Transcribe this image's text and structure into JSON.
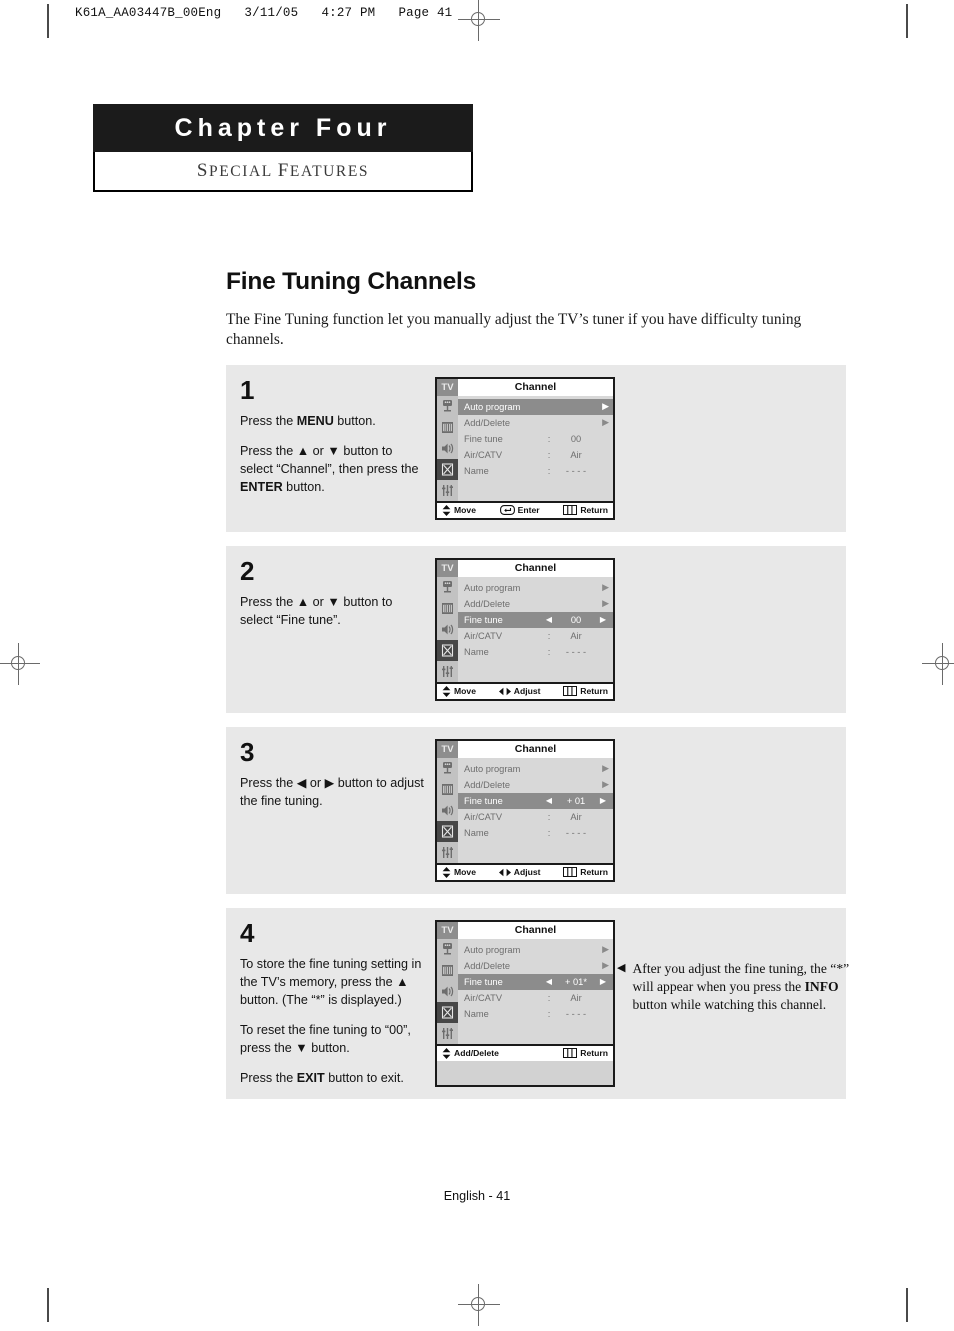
{
  "print_slug": "K61A_AA03447B_00Eng   3/11/05   4:27 PM   Page 41",
  "chapter": {
    "title": "Chapter Four",
    "subtitle_small_caps": "S",
    "subtitle": "PECIAL ",
    "subtitle_small_caps2": "F",
    "subtitle2": "EATURES",
    "subtitle_full": "SPECIAL FEATURES"
  },
  "section": {
    "title": "Fine Tuning Channels",
    "intro": "The Fine Tuning function let you manually adjust the TV’s tuner if you have difficulty tuning channels."
  },
  "osd_common": {
    "tv_tag": "TV",
    "menu_title": "Channel",
    "icons": [
      "antenna-icon",
      "picture-icon",
      "speaker-icon",
      "setup-icon",
      "equalizer-icon"
    ],
    "selected_icon_index": 3,
    "labels": {
      "auto_program": "Auto program",
      "add_delete": "Add/Delete",
      "fine_tune": "Fine tune",
      "air_catv": "Air/CATV",
      "name": "Name"
    },
    "values": {
      "air_catv": "Air",
      "name": "- - - -"
    },
    "footer_labels": {
      "move": "Move",
      "enter": "Enter",
      "return": "Return",
      "adjust": "Adjust",
      "add_delete": "Add/Delete"
    }
  },
  "steps": [
    {
      "number": "1",
      "paragraphs": [
        {
          "parts": [
            {
              "t": "Press the ",
              "b": false
            },
            {
              "t": "MENU",
              "b": true
            },
            {
              "t": " button.",
              "b": false
            }
          ]
        },
        {
          "parts": [
            {
              "t": "Press the ▲ or ▼ button to select “Channel”, then press the ",
              "b": false
            },
            {
              "t": "ENTER",
              "b": true
            },
            {
              "t": " button.",
              "b": false
            }
          ]
        }
      ],
      "osd": {
        "highlight_row": "auto_program",
        "fine_tune_value": "00",
        "fine_tune_has_arrows": false,
        "footer": [
          "move",
          "enter",
          "return"
        ]
      }
    },
    {
      "number": "2",
      "paragraphs": [
        {
          "parts": [
            {
              "t": "Press the ▲ or ▼ button to select “Fine tune”.",
              "b": false
            }
          ]
        }
      ],
      "osd": {
        "highlight_row": "fine_tune",
        "fine_tune_value": "00",
        "fine_tune_has_arrows": true,
        "footer": [
          "move",
          "adjust",
          "return"
        ]
      }
    },
    {
      "number": "3",
      "paragraphs": [
        {
          "parts": [
            {
              "t": "Press the ◀ or ▶ button to adjust the fine tuning.",
              "b": false
            }
          ]
        }
      ],
      "osd": {
        "highlight_row": "fine_tune",
        "fine_tune_value": "+ 01",
        "fine_tune_has_arrows": true,
        "footer": [
          "move",
          "adjust",
          "return"
        ]
      }
    },
    {
      "number": "4",
      "paragraphs": [
        {
          "parts": [
            {
              "t": "To store the fine tuning setting in the TV’s memory, press the ▲ button. (The “*” is displayed.)",
              "b": false
            }
          ]
        },
        {
          "parts": [
            {
              "t": "To reset the fine tuning to “00”, press the ▼ button.",
              "b": false
            }
          ]
        },
        {
          "parts": [
            {
              "t": "Press the ",
              "b": false
            },
            {
              "t": "EXIT",
              "b": true
            },
            {
              "t": " button to exit.",
              "b": false
            }
          ]
        }
      ],
      "osd": {
        "highlight_row": "fine_tune",
        "fine_tune_value": "+ 01*",
        "fine_tune_has_arrows": true,
        "footer": [
          "add_delete",
          "return"
        ]
      }
    }
  ],
  "sidenote": {
    "bullet": "◀",
    "parts": [
      {
        "t": "After you adjust the fine tuning, the “*” will appear when you press the ",
        "b": false
      },
      {
        "t": "INFO",
        "b": true
      },
      {
        "t": " button while watching this channel.",
        "b": false
      }
    ]
  },
  "page_footer": "English - 41",
  "colors": {
    "banner_bg": "#1b1b1b",
    "panel_bg": "#e8e8e8",
    "osd_bg": "#d8d8d8",
    "osd_highlight": "#8c8c8c",
    "osd_icon_selected": "#474747"
  }
}
